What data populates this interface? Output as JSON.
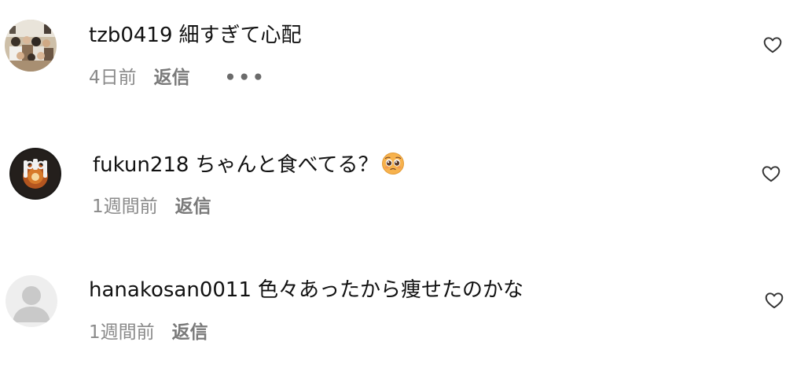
{
  "comments": [
    {
      "username": "tzb0419",
      "text": "細すぎて心配",
      "time": "4日前",
      "reply_label": "返信",
      "more_label": "•••",
      "avatar": "group-photo"
    },
    {
      "username": "fukun218",
      "text": "ちゃんと食べてる？",
      "emoji": "pleading-face",
      "time": "1週間前",
      "reply_label": "返信",
      "avatar": "dark-orange-logo"
    },
    {
      "username": "hanakosan0011",
      "text": "色々あったから痩せたのかな",
      "time": "1週間前",
      "reply_label": "返信",
      "avatar": "default-user"
    }
  ],
  "colors": {
    "meta_text": "#8a8a8a",
    "heart_outline": "#333333",
    "default_avatar_bg": "#eeeeee",
    "default_avatar_fg": "#c9c9c9"
  }
}
